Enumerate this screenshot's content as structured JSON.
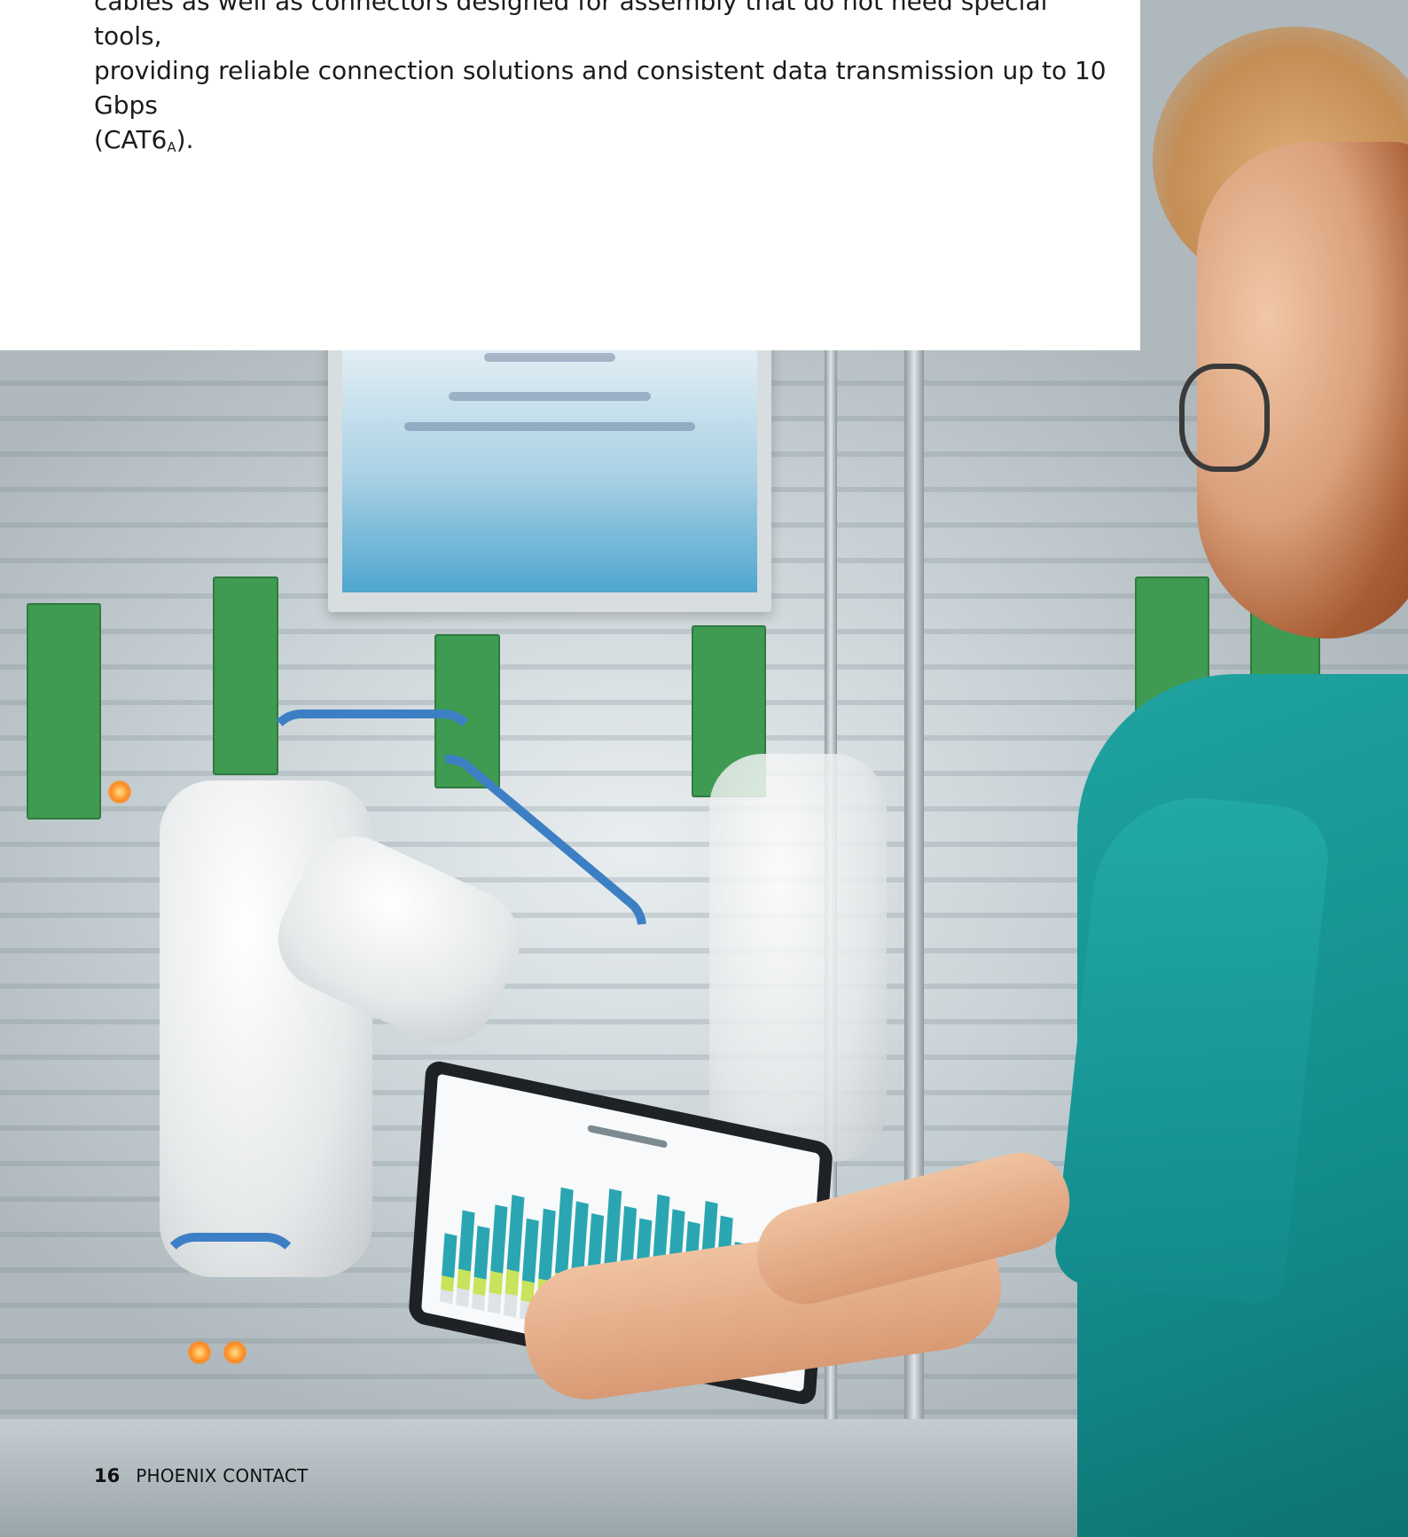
{
  "article": {
    "line1": "cables as well as connectors designed for assembly that do not need special tools,",
    "line2": "providing reliable connection solutions and consistent data transmission up to 10 Gbps",
    "line3_prefix": "(CAT6",
    "line3_sub": "A",
    "line3_suffix": ")."
  },
  "footer": {
    "page_number": "16",
    "brand": "PHOENIX CONTACT"
  },
  "photo": {
    "subject": "engineer-with-tablet-in-automated-factory",
    "accent_colors": {
      "shirt": "#1fa3a1",
      "cables": "#3d7fc4",
      "boards": "#3f9a52"
    }
  }
}
